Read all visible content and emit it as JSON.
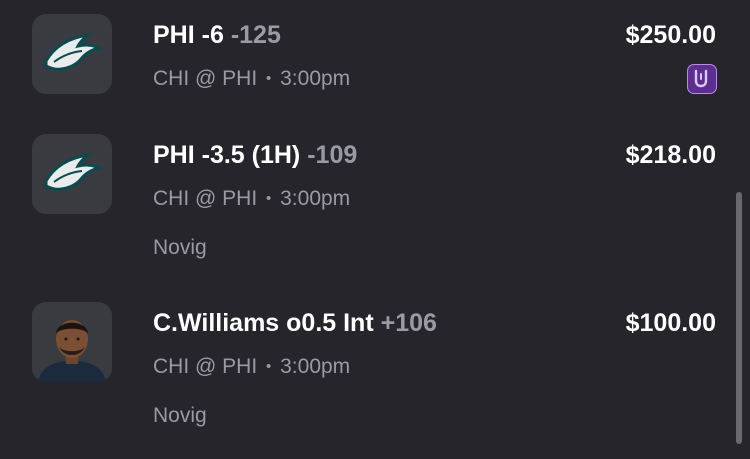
{
  "bets": [
    {
      "team_icon": "eagles-logo-icon",
      "pick": "PHI -6",
      "odds": "-125",
      "matchup": "CHI @ PHI",
      "separator": "•",
      "time": "3:00pm",
      "amount": "$250.00",
      "book_icon": "sportsbook-badge-icon",
      "book": ""
    },
    {
      "team_icon": "eagles-logo-icon",
      "pick": "PHI -3.5 (1H)",
      "odds": "-109",
      "matchup": "CHI @ PHI",
      "separator": "•",
      "time": "3:00pm",
      "amount": "$218.00",
      "book": "Novig"
    },
    {
      "team_icon": "player-headshot",
      "pick": "C.Williams o0.5 Int",
      "odds": "+106",
      "matchup": "CHI @ PHI",
      "separator": "•",
      "time": "3:00pm",
      "amount": "$100.00",
      "book": "Novig"
    }
  ],
  "colors": {
    "background": "#25252b",
    "tile": "#3a3a41",
    "primary_text": "#ffffff",
    "secondary_text": "#9a9aa2",
    "book_badge": "#5c2f8c"
  }
}
